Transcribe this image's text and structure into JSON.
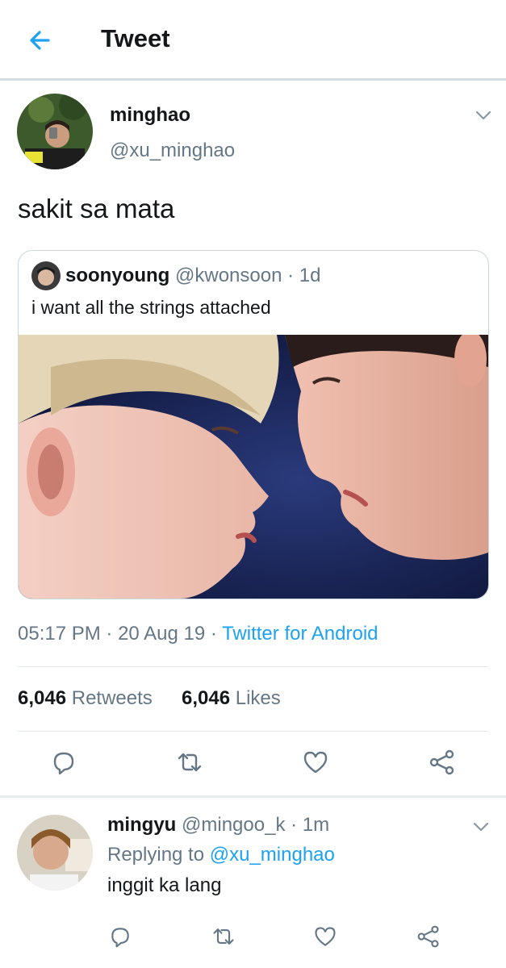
{
  "header": {
    "title": "Tweet",
    "back_icon": "arrow-left-icon"
  },
  "tweet": {
    "author_name": "minghao",
    "author_handle": "@xu_minghao",
    "text": "sakit sa mata",
    "quoted": {
      "author_name": "soonyoung",
      "author_handle": "@kwonsoon",
      "time": "· 1d",
      "text": "i want all the strings attached"
    },
    "time": "05:17 PM",
    "sep1": "·",
    "date": "20 Aug 19",
    "sep2": "·",
    "source": "Twitter for Android",
    "retweets_count": "6,046",
    "retweets_label": "Retweets",
    "likes_count": "6,046",
    "likes_label": "Likes"
  },
  "reply": {
    "author_name": "mingyu",
    "author_handle": "@mingoo_k",
    "time": "· 1m",
    "replying_prefix": "Replying to",
    "replying_handle": "@xu_minghao",
    "text": "inggit ka lang"
  },
  "colors": {
    "accent": "#1da1f2",
    "muted": "#657786",
    "text": "#14171a",
    "border": "#e1e8ed"
  }
}
